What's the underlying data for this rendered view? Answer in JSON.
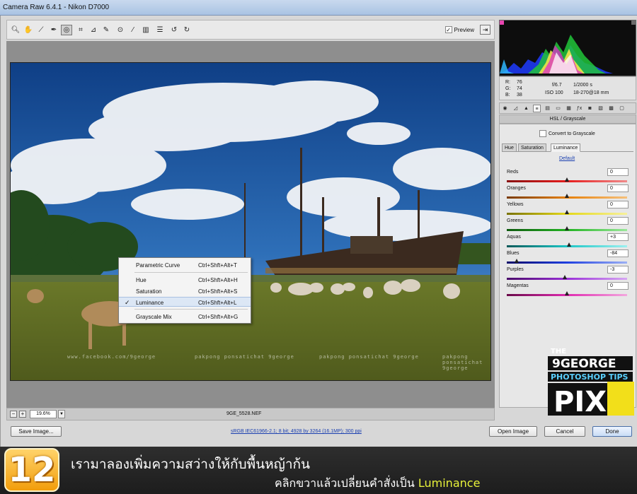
{
  "window": {
    "title": "Camera Raw 6.4.1  -  Nikon D7000"
  },
  "toolbar": {
    "tools": [
      "zoom-icon",
      "hand-icon",
      "white-balance-icon",
      "color-sampler-icon",
      "target-adjust-icon",
      "crop-icon",
      "straighten-icon",
      "spot-removal-icon",
      "red-eye-icon",
      "adjustment-brush-icon",
      "graduated-filter-icon",
      "preferences-icon",
      "rotate-ccw-icon",
      "rotate-cw-icon"
    ],
    "preview_label": "Preview",
    "preview_checked": "✓"
  },
  "context_menu": {
    "items": [
      {
        "label": "Parametric Curve",
        "shortcut": "Ctrl+Shft+Alt+T"
      },
      {
        "label": "Hue",
        "shortcut": "Ctrl+Shft+Alt+H"
      },
      {
        "label": "Saturation",
        "shortcut": "Ctrl+Shft+Alt+S"
      },
      {
        "label": "Luminance",
        "shortcut": "Ctrl+Shft+Alt+L",
        "checked": "✓"
      },
      {
        "label": "Grayscale Mix",
        "shortcut": "Ctrl+Shft+Alt+G"
      }
    ]
  },
  "watermarks": [
    "www.facebook.com/9george",
    "pakpong ponsatichat 9george",
    "pakpong ponsatichat 9george",
    "pakpong ponsatichat 9george"
  ],
  "canvas_bottom": {
    "minus": "−",
    "plus": "+",
    "zoom": "19.6%",
    "filename": "9GE_5528.NEF"
  },
  "info": {
    "r_label": "R:",
    "r": "76",
    "g_label": "G:",
    "g": "74",
    "b_label": "B:",
    "b": "38",
    "aperture": "f/6.7",
    "shutter": "1/2000 s",
    "iso": "ISO 100",
    "lens": "18-270@18 mm"
  },
  "panel": {
    "title": "HSL / Grayscale",
    "convert_label": "Convert to Grayscale",
    "subtabs": [
      "Hue",
      "Saturation",
      "Luminance"
    ],
    "default_link": "Default",
    "sliders": [
      {
        "label": "Reds",
        "value": "0",
        "pos": 0.5,
        "colors": [
          "#8a1010",
          "#e61c1c",
          "#f08a8a"
        ]
      },
      {
        "label": "Oranges",
        "value": "0",
        "pos": 0.5,
        "colors": [
          "#7a3a00",
          "#e6800a",
          "#f6c07a"
        ]
      },
      {
        "label": "Yellows",
        "value": "0",
        "pos": 0.5,
        "colors": [
          "#7a7300",
          "#e4d81a",
          "#f7f19a"
        ]
      },
      {
        "label": "Greens",
        "value": "0",
        "pos": 0.5,
        "colors": [
          "#0f5a0f",
          "#21b321",
          "#9be89b"
        ]
      },
      {
        "label": "Aquas",
        "value": "+3",
        "pos": 0.515,
        "colors": [
          "#0a5a5a",
          "#1cc6c6",
          "#9cf0f0"
        ]
      },
      {
        "label": "Blues",
        "value": "-84",
        "pos": 0.08,
        "colors": [
          "#0a0a6a",
          "#1f3fe0",
          "#9cb0f5"
        ]
      },
      {
        "label": "Purples",
        "value": "-3",
        "pos": 0.485,
        "colors": [
          "#4a0a6a",
          "#9a2fd8",
          "#d7a7f3"
        ]
      },
      {
        "label": "Magentas",
        "value": "0",
        "pos": 0.5,
        "colors": [
          "#6a0a4a",
          "#e02bb0",
          "#f3a7de"
        ]
      }
    ]
  },
  "footer": {
    "save_label": "Save Image...",
    "workflow_link": "sRGB IEC61966-2.1; 8 bit; 4928 by 3264 (16.1MP); 300 ppi",
    "open_label": "Open Image",
    "cancel_label": "Cancel",
    "done_label": "Done"
  },
  "logo": {
    "line1": "THE",
    "line2": "9GEORGE",
    "line3": "PHOTOSHOP TIPS",
    "line4": "PIX"
  },
  "instruction": {
    "step": "12",
    "line1": "เรามาลองเพิ่มความสว่างให้กับพื้นหญ้าก้น",
    "line2": "คลิกขวาแล้วเปลี่ยนคำสั่งเป็น",
    "line2_highlight": "Luminance"
  }
}
